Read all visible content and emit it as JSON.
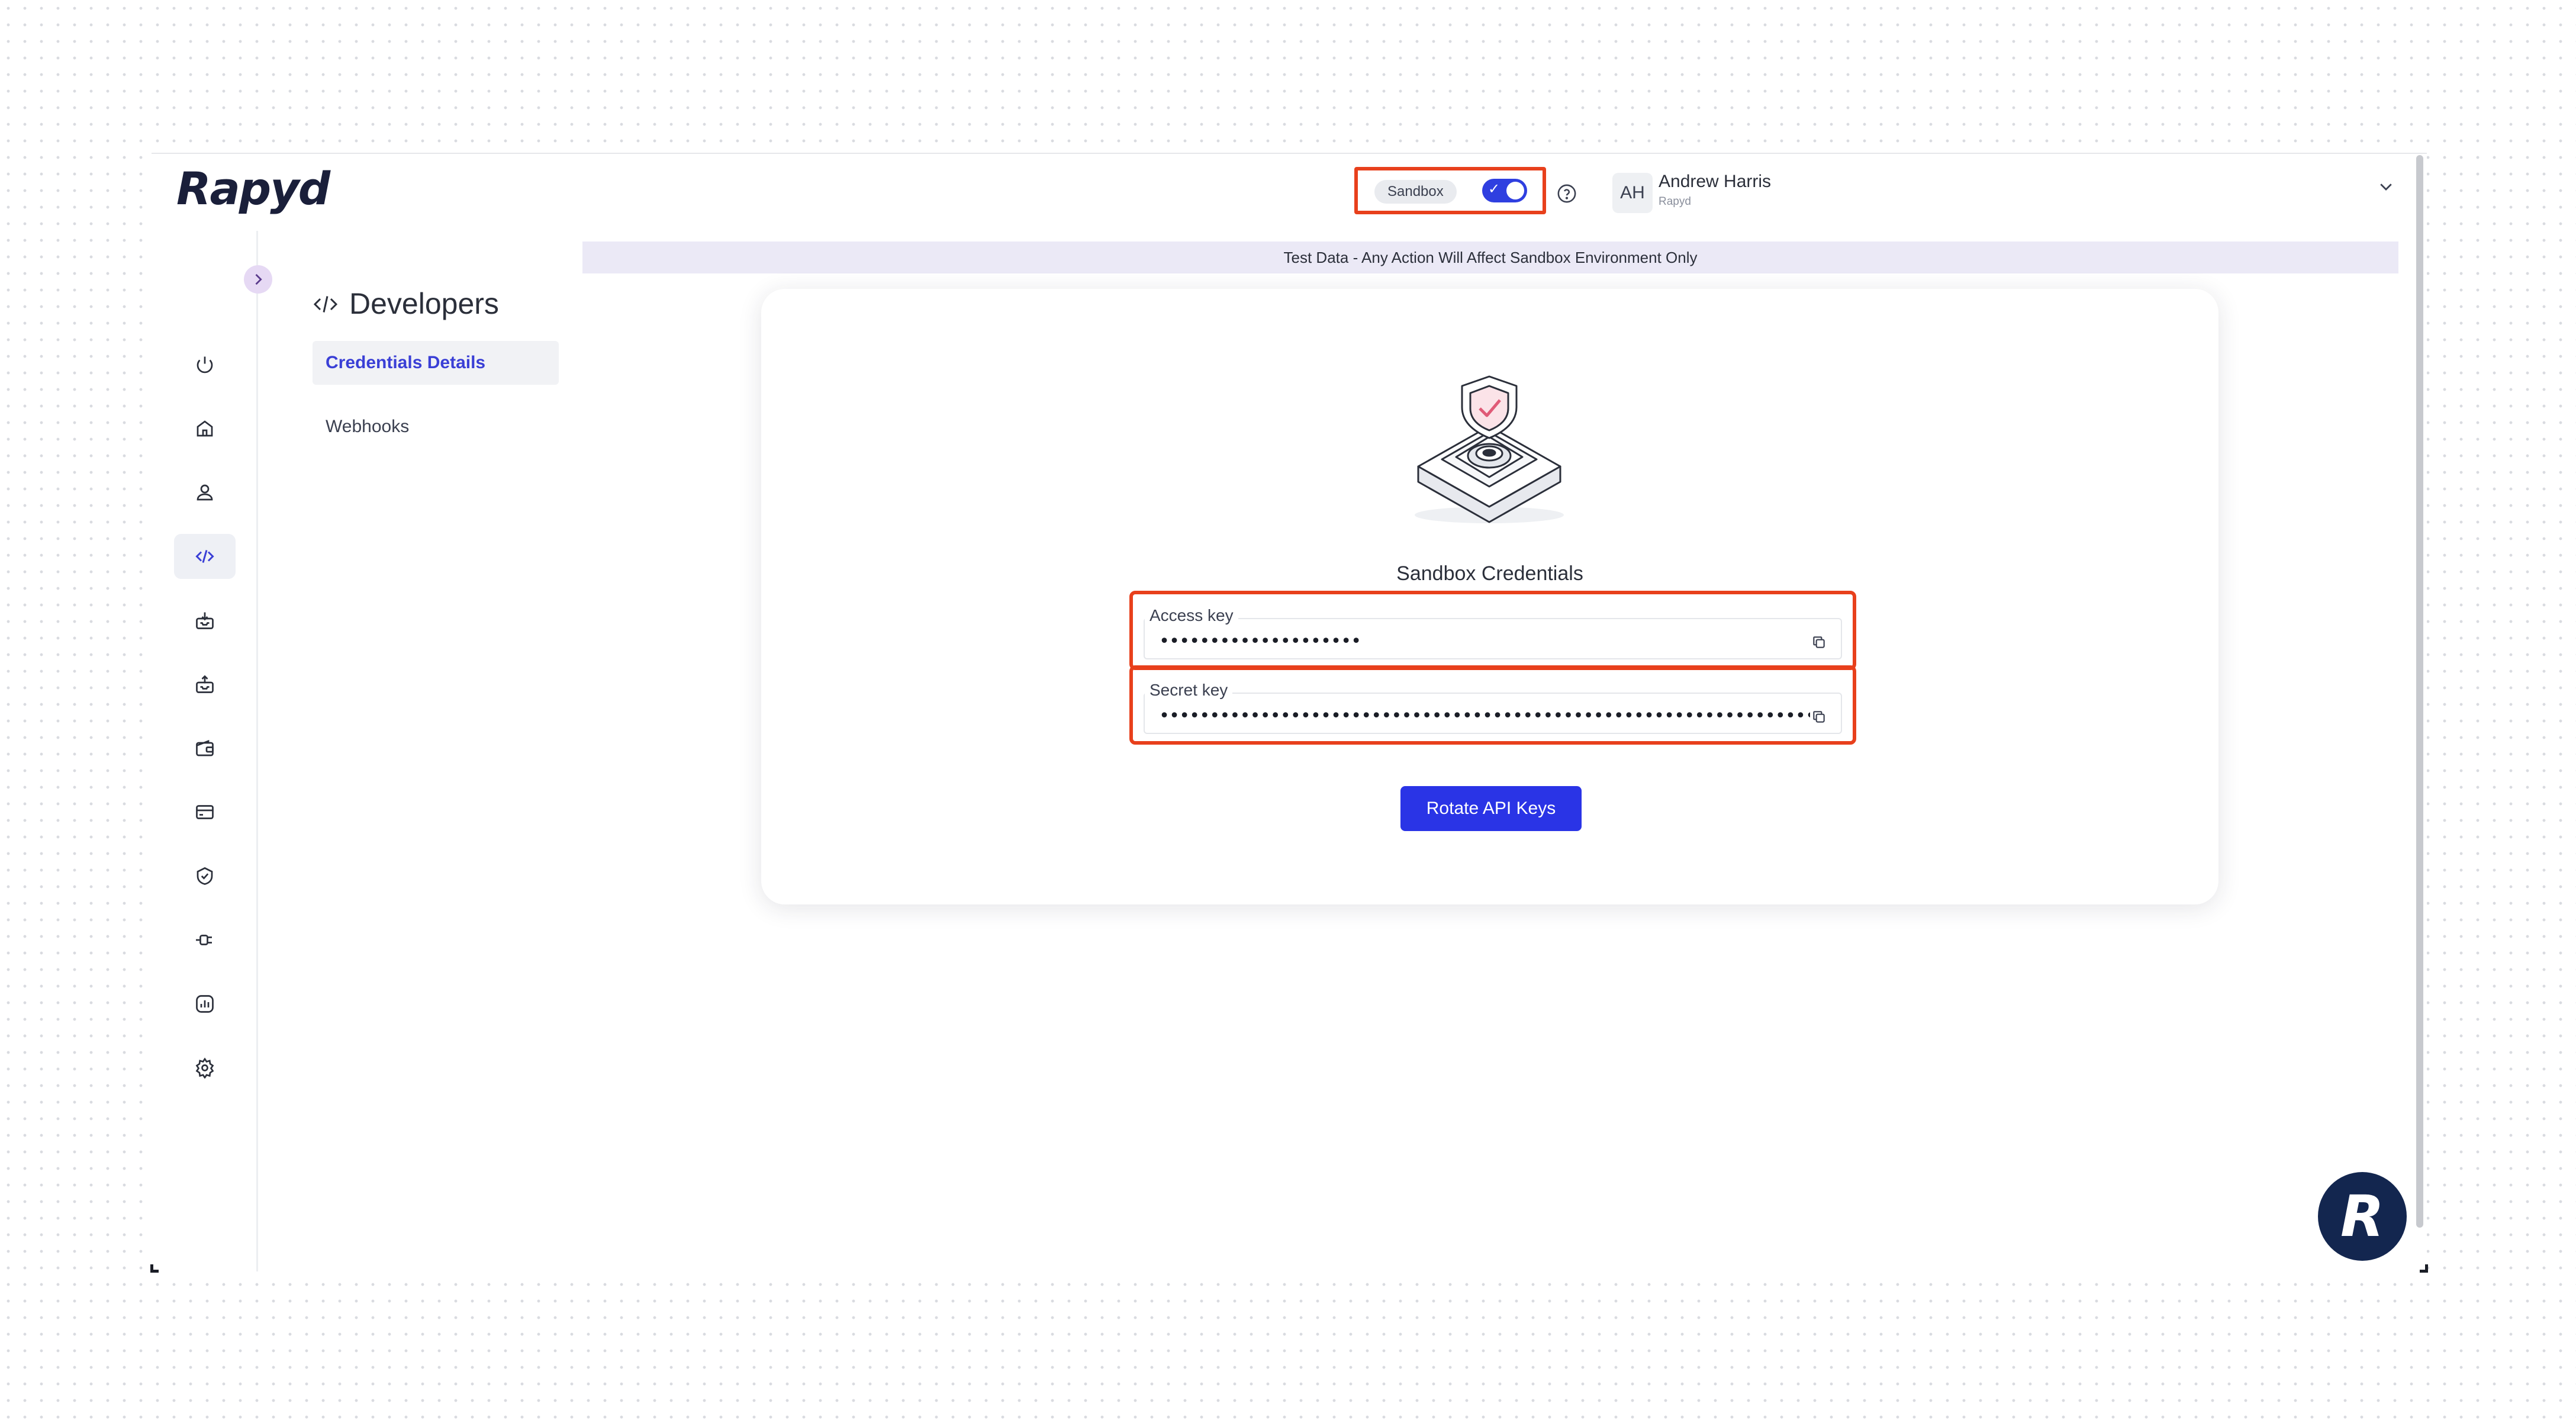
{
  "header": {
    "logo": "Rapyd",
    "environment_badge": "Sandbox",
    "sandbox_toggle": "on",
    "user": {
      "initials": "AH",
      "name": "Andrew Harris",
      "org": "Rapyd"
    }
  },
  "banner": "Test Data - Any Action Will Affect Sandbox Environment Only",
  "rail": {
    "items": [
      "power-icon",
      "home-icon",
      "user-icon",
      "code-icon",
      "inbox-download-icon",
      "inbox-upload-icon",
      "wallet-icon",
      "card-icon",
      "shield-check-icon",
      "plug-icon",
      "report-icon",
      "settings-icon"
    ],
    "active": "code-icon"
  },
  "subnav": {
    "title": "Developers",
    "items": [
      {
        "label": "Credentials Details",
        "active": true
      },
      {
        "label": "Webhooks",
        "active": false
      }
    ]
  },
  "card": {
    "title": "Sandbox Credentials",
    "access_key": {
      "label": "Access key",
      "value": "••••••••••••••••••••"
    },
    "secret_key": {
      "label": "Secret key",
      "value": "•••••••••••••••••••••••••••••••••••••••••••••••••••••••••••••••••••••••••••••••"
    },
    "rotate_button": "Rotate API Keys"
  },
  "fab": {
    "letter": "R"
  },
  "colors": {
    "accent": "#2a34e6",
    "highlight": "#e8401c",
    "banner_bg": "#ebe9f6",
    "brand_dark": "#13264f"
  }
}
